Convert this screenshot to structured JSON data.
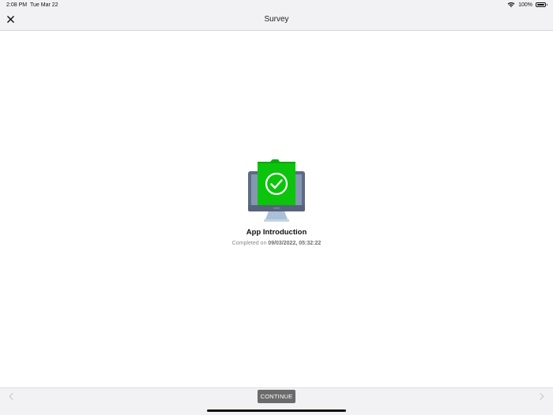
{
  "status_bar": {
    "time": "2:08 PM",
    "date": "Tue Mar 22",
    "battery_percent": "100%",
    "icons": [
      "wifi-icon",
      "battery-icon"
    ]
  },
  "nav": {
    "title": "Survey",
    "close_icon": "close-icon"
  },
  "survey": {
    "title": "App Introduction",
    "completed_prefix": "Completed on",
    "completed_date": "09/03/2022, 05:32:22",
    "illustration_icon": "monitor-folder-check-icon"
  },
  "toolbar": {
    "continue_label": "CONTINUE",
    "prev_icon": "chevron-left-icon",
    "next_icon": "chevron-right-icon"
  },
  "colors": {
    "folder_green": "#0cc40c",
    "monitor_frame": "#5d6b84",
    "monitor_stand": "#a9c0d8",
    "continue_button_bg": "#6b6b6b",
    "bar_bg": "#f2f2f4"
  }
}
